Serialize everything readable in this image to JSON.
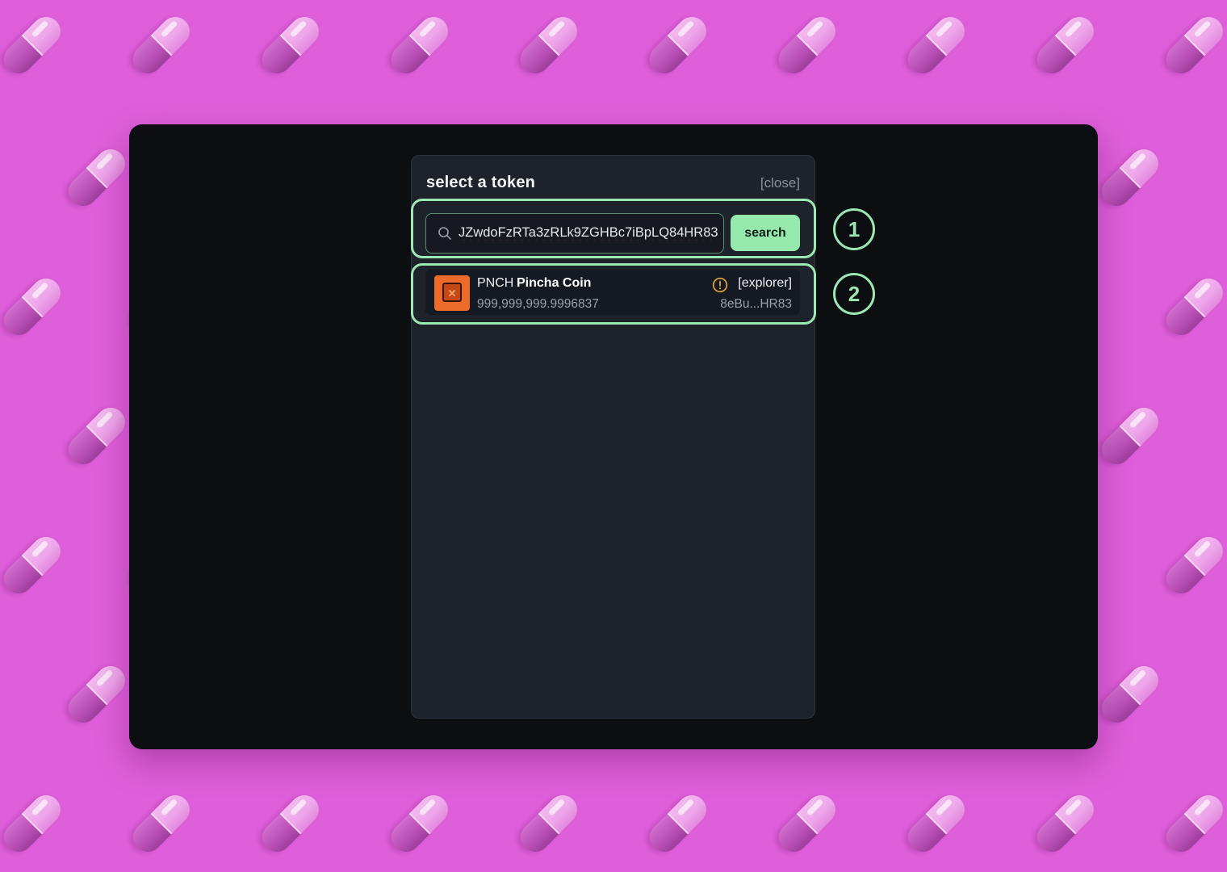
{
  "background": {
    "color": "#df5fda",
    "pattern_icon": "pill-icon"
  },
  "modal": {
    "title": "select a token",
    "close_label": "[close]"
  },
  "search": {
    "value": "JZwdoFzRTa3zRLk9ZGHBc7iBpLQ84HR83",
    "icon": "search-icon",
    "button_label": "search"
  },
  "results": [
    {
      "symbol": "PNCH",
      "name": "Pincha Coin",
      "balance": "999,999,999.9996837",
      "explorer_label": "[explorer]",
      "address": "8eBu...HR83",
      "warning_icon": "warning-icon"
    }
  ],
  "annotations": [
    {
      "label": "1",
      "target": "search-row"
    },
    {
      "label": "2",
      "target": "token-row"
    }
  ],
  "colors": {
    "accent": "#96e9ad",
    "annotation": "#9de7b3",
    "warning": "#e0a532",
    "token_icon": "#ec6a2a"
  }
}
